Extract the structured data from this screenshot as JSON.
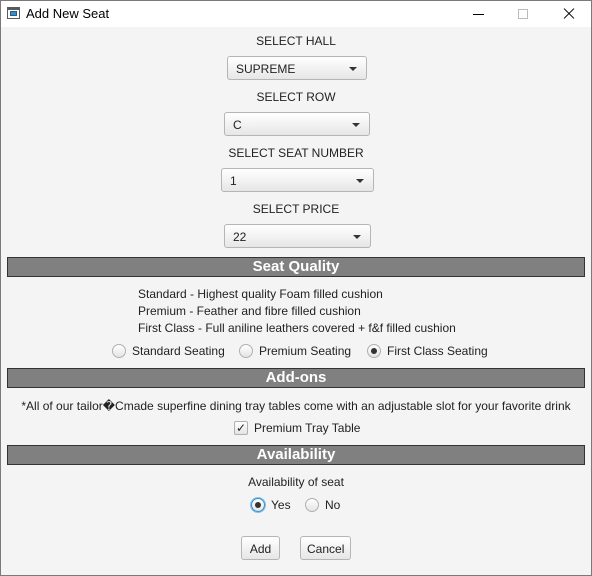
{
  "window": {
    "title": "Add New Seat"
  },
  "hall": {
    "label": "SELECT HALL",
    "value": "SUPREME"
  },
  "row": {
    "label": "SELECT ROW",
    "value": "C"
  },
  "seat_number": {
    "label": "SELECT SEAT NUMBER",
    "value": "1"
  },
  "price": {
    "label": "SELECT PRICE",
    "value": "22"
  },
  "seat_quality": {
    "heading": "Seat Quality",
    "descriptions": [
      "Standard - Highest quality Foam filled cushion",
      "Premium - Feather and fibre filled cushion",
      "First Class - Full aniline leathers covered + f&f filled cushion"
    ],
    "options": [
      {
        "label": "Standard Seating",
        "selected": false
      },
      {
        "label": "Premium Seating",
        "selected": false
      },
      {
        "label": "First Class Seating",
        "selected": true
      }
    ]
  },
  "addons": {
    "heading": "Add-ons",
    "note": "*All of our tailor�Cmade superfine dining tray tables come with an adjustable slot for your favorite drink",
    "tray_table": {
      "label": "Premium Tray Table",
      "checked": true
    }
  },
  "availability": {
    "heading": "Availability",
    "label": "Availability of seat",
    "options": [
      {
        "label": "Yes",
        "selected": true
      },
      {
        "label": "No",
        "selected": false
      }
    ]
  },
  "actions": {
    "add_label": "Add",
    "cancel_label": "Cancel"
  },
  "icons": {
    "check": "✓"
  }
}
